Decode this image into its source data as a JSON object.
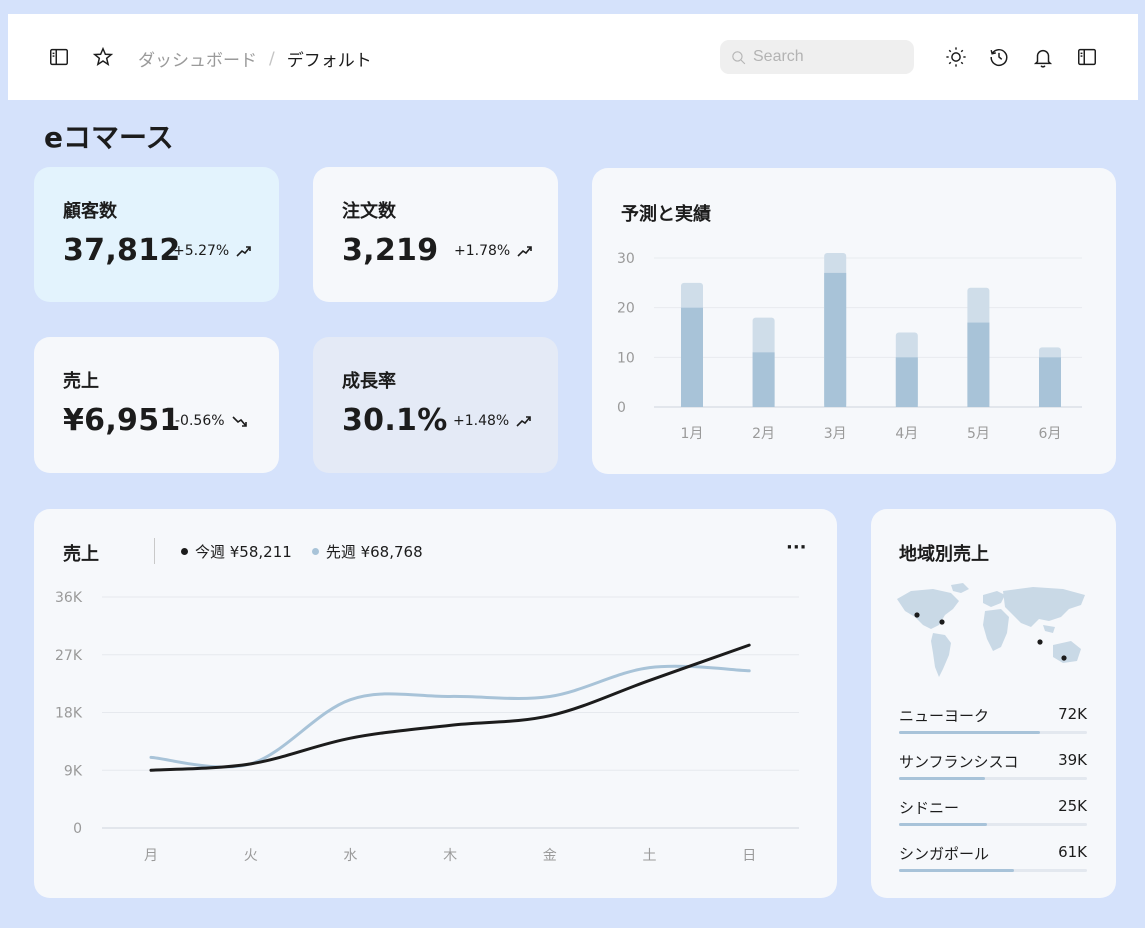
{
  "header": {
    "breadcrumb_parent": "ダッシュボード",
    "breadcrumb_separator": "/",
    "breadcrumb_current": "デフォルト",
    "search_placeholder": "Search"
  },
  "page_title": "eコマース",
  "stats": [
    {
      "label": "顧客数",
      "value": "37,812",
      "change": "+5.27%",
      "trend": "up",
      "bg": "#e3f3fd"
    },
    {
      "label": "注文数",
      "value": "3,219",
      "change": "+1.78%",
      "trend": "up",
      "bg": "#f6f8fb"
    },
    {
      "label": "売上",
      "value": "¥6,951",
      "change": "-0.56%",
      "trend": "down",
      "bg": "#f6f8fb"
    },
    {
      "label": "成長率",
      "value": "30.1%",
      "change": "+1.48%",
      "trend": "up",
      "bg": "#e4eaf6"
    }
  ],
  "forecast": {
    "title": "予測と実績",
    "chart_data": {
      "type": "bar",
      "categories": [
        "1月",
        "2月",
        "3月",
        "4月",
        "5月",
        "6月"
      ],
      "series": [
        {
          "values": [
            20,
            11,
            27,
            10,
            17,
            10
          ]
        },
        {
          "values": [
            25,
            18,
            31,
            15,
            24,
            12
          ]
        }
      ],
      "ylim": [
        0,
        30
      ],
      "yticks": [
        "0",
        "10",
        "20",
        "30"
      ],
      "colors": [
        "#a8c3d8",
        "#cfdde9"
      ]
    }
  },
  "sales": {
    "title": "売上",
    "legend": [
      {
        "label": "今週 ¥58,211",
        "color": "#1c1c1c"
      },
      {
        "label": "先週 ¥68,768",
        "color": "#a8c3d8"
      }
    ],
    "more_label": "···",
    "chart_data": {
      "type": "line",
      "categories": [
        "月",
        "火",
        "水",
        "木",
        "金",
        "土",
        "日"
      ],
      "yticks": [
        "0",
        "9K",
        "18K",
        "27K",
        "36K"
      ],
      "ylim": [
        0,
        36000
      ],
      "series": [
        {
          "name": "今週",
          "color": "#1c1c1c",
          "values": [
            9000,
            10000,
            14000,
            16000,
            17500,
            23000,
            28500
          ]
        },
        {
          "name": "先週",
          "color": "#a8c3d8",
          "values": [
            11000,
            10000,
            20000,
            20500,
            20500,
            25000,
            24500
          ]
        }
      ]
    }
  },
  "regions": {
    "title": "地域別売上",
    "items": [
      {
        "name": "ニューヨーク",
        "value": "72K",
        "fraction": 0.75
      },
      {
        "name": "サンフランシスコ",
        "value": "39K",
        "fraction": 0.46
      },
      {
        "name": "シドニー",
        "value": "25K",
        "fraction": 0.47
      },
      {
        "name": "シンガポール",
        "value": "61K",
        "fraction": 0.61
      }
    ]
  }
}
